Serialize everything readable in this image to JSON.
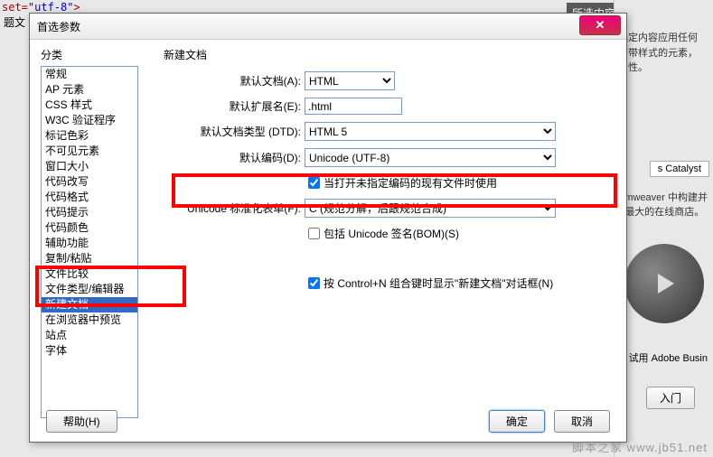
{
  "top_code_a": "set=",
  "top_code_b": "\"utf-8\"",
  "top_code_c": ">",
  "top_label": "题文",
  "bg": {
    "header": "所选内容的摘要",
    "text1": "选定内容应用任何",
    "text2": "不带样式的元素，",
    "text3": "属性。",
    "catalyst": "s Catalyst",
    "note1": "mweaver 中构建并",
    "note2": "最大的在线商店。",
    "note3": "试用 Adobe Busin",
    "btn": "入门"
  },
  "dialog": {
    "title": "首选参数",
    "categories_label": "分类",
    "categories": [
      "常规",
      "AP 元素",
      "CSS 样式",
      "W3C 验证程序",
      "标记色彩",
      "不可见元素",
      "窗口大小",
      "代码改写",
      "代码格式",
      "代码提示",
      "代码颜色",
      "辅助功能",
      "复制/粘贴",
      "文件比较",
      "文件类型/编辑器",
      "新建文档",
      "在浏览器中预览",
      "站点",
      "字体"
    ],
    "selected_index": 15,
    "section_title": "新建文档",
    "rows": {
      "default_doc": {
        "label": "默认文档(A):",
        "value": "HTML"
      },
      "default_ext": {
        "label": "默认扩展名(E):",
        "value": ".html"
      },
      "dtd": {
        "label": "默认文档类型 (DTD):",
        "value": "HTML 5"
      },
      "encoding": {
        "label": "默认编码(D):",
        "value": "Unicode (UTF-8)"
      },
      "encoding_cb": {
        "checked": true,
        "label": "当打开未指定编码的现有文件时使用"
      },
      "normalization": {
        "label": "Unicode 标准化表单(F):",
        "value": "C (规范分解，后跟规范合成)"
      },
      "bom_cb": {
        "checked": false,
        "label": "包括 Unicode 签名(BOM)(S)"
      },
      "ctrl_n_cb": {
        "checked": true,
        "label": "按 Control+N 组合键时显示\"新建文档\"对话框(N)"
      }
    },
    "buttons": {
      "help": "帮助(H)",
      "ok": "确定",
      "cancel": "取消"
    }
  },
  "watermark": "脚本之家 www.jb51.net"
}
